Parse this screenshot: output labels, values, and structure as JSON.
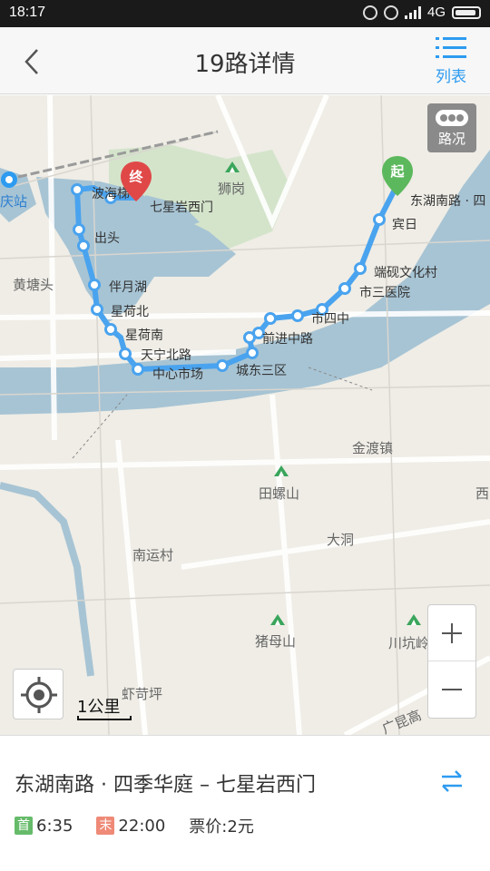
{
  "status_bar": {
    "time": "18:17",
    "network": "4G"
  },
  "header": {
    "title": "19路详情",
    "list_label": "列表"
  },
  "map": {
    "traffic_label": "路况",
    "start_pin": "起",
    "end_pin": "终",
    "scale_label": "1公里",
    "stops": [
      {
        "name": "东湖南路 · 四"
      },
      {
        "name": "宾日"
      },
      {
        "name": "端砚文化村"
      },
      {
        "name": "市三医院"
      },
      {
        "name": "市四中"
      },
      {
        "name": "前进中路"
      },
      {
        "name": "城东三区"
      },
      {
        "name": "中心市场"
      },
      {
        "name": "天宁北路"
      },
      {
        "name": "星荷南"
      },
      {
        "name": "星荷北"
      },
      {
        "name": "伴月湖"
      },
      {
        "name": "出头"
      },
      {
        "name": "波海梯"
      },
      {
        "name": "七星岩西门"
      }
    ],
    "places": [
      {
        "name": "狮岗"
      },
      {
        "name": "黄塘头"
      },
      {
        "name": "金渡镇"
      },
      {
        "name": "田螺山"
      },
      {
        "name": "大洞"
      },
      {
        "name": "南运村"
      },
      {
        "name": "猪母山"
      },
      {
        "name": "川坑岭"
      },
      {
        "name": "虾苛坪"
      },
      {
        "name": "广昆高"
      },
      {
        "name": "庆站"
      },
      {
        "name": "西"
      }
    ]
  },
  "route": {
    "name": "东湖南路 · 四季华庭 – 七星岩西门",
    "first_badge": "首",
    "first_time": "6:35",
    "last_badge": "末",
    "last_time": "22:00",
    "fare": "票价:2元"
  },
  "colors": {
    "accent": "#2d9bf0",
    "route_line": "#4aa3ee",
    "start_pin": "#5cb85c",
    "end_pin": "#e04848",
    "water": "#a7c4d4"
  }
}
